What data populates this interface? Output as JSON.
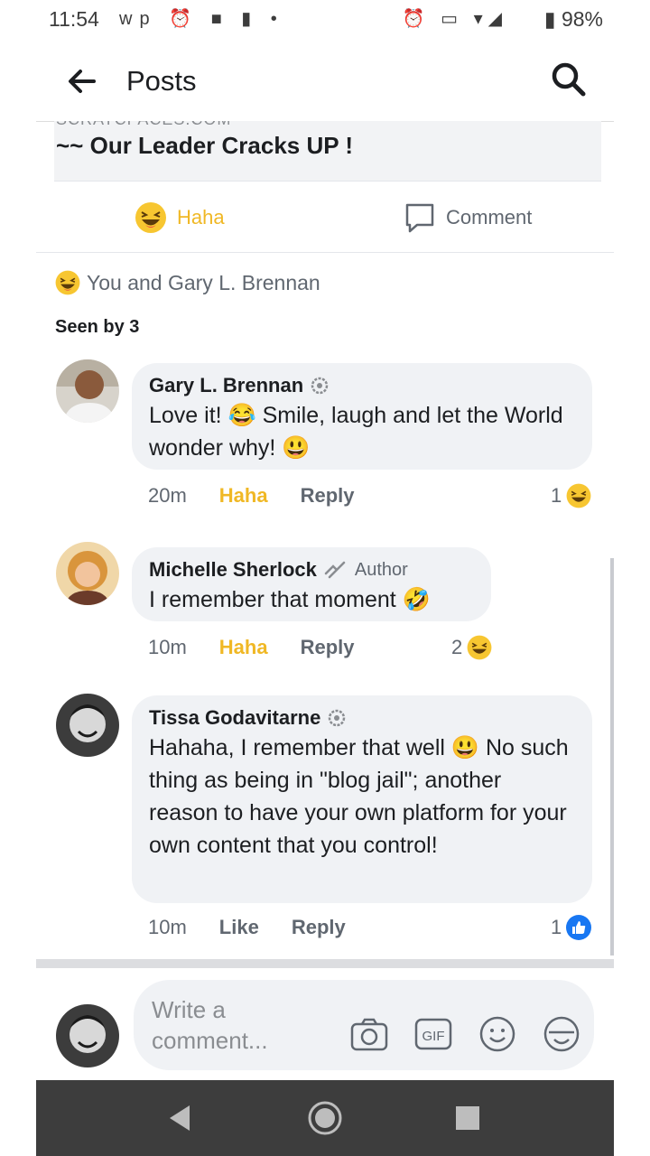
{
  "status_bar": {
    "time": "11:54",
    "left_icons": "wp ⏰ ■ ▮ •",
    "right_icons": "⏰ ▭ ▾◢",
    "battery": "▮ 98%"
  },
  "header": {
    "title": "Posts"
  },
  "shared_post": {
    "domain": "SCRATCPACES.COM",
    "link_title": "~~ Our Leader Cracks UP !"
  },
  "actions": {
    "haha_label": "Haha",
    "comment_label": "Comment"
  },
  "reactions": {
    "summary": "You and Gary L. Brennan",
    "seen_by": "Seen by 3"
  },
  "comments": [
    {
      "name": "Gary L. Brennan",
      "text": "Love it! 😂  Smile, laugh and let the World wonder why! 😃",
      "time": "20m",
      "reaction_label": "Haha",
      "reply_label": "Reply",
      "reaction_count": "1"
    },
    {
      "name": "Michelle Sherlock",
      "author_label": "Author",
      "text": "I remember that moment 🤣",
      "time": "10m",
      "reaction_label": "Haha",
      "reply_label": "Reply",
      "reaction_count": "2"
    },
    {
      "name": "Tissa Godavitarne",
      "text": "Hahaha, I remember that well 😃  No such thing as being in \"blog jail\"; another reason to have your own platform for your own content that you control!",
      "time": "10m",
      "reaction_label": "Like",
      "reply_label": "Reply",
      "reaction_count": "1"
    }
  ],
  "composer": {
    "placeholder": "Write a comment..."
  },
  "colors": {
    "haha": "#f0b825",
    "like": "#1877f2",
    "text": "#1c1e21",
    "secondary": "#606770",
    "bubble": "#f0f2f5",
    "navbar": "#3d3d3d"
  }
}
